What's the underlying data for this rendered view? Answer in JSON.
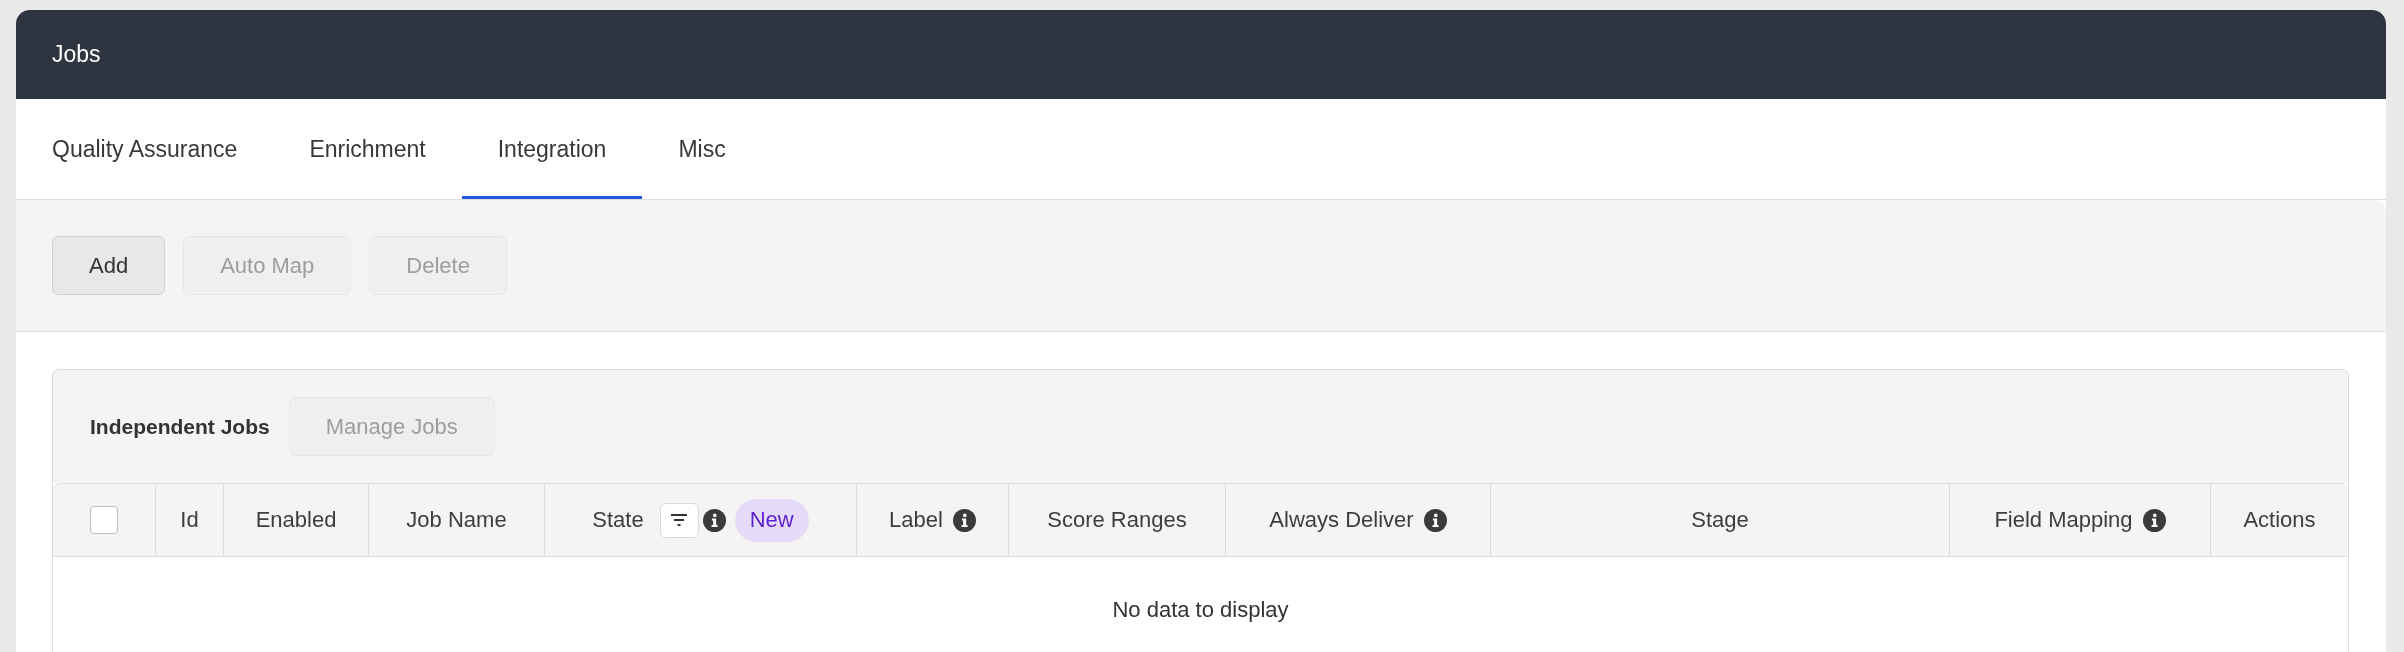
{
  "window": {
    "title": "Jobs"
  },
  "tabs": [
    {
      "label": "Quality Assurance",
      "selected": false
    },
    {
      "label": "Enrichment",
      "selected": false
    },
    {
      "label": "Integration",
      "selected": true
    },
    {
      "label": "Misc",
      "selected": false
    }
  ],
  "toolbar": {
    "buttons": [
      {
        "label": "Add",
        "disabled": false
      },
      {
        "label": "Auto Map",
        "disabled": true
      },
      {
        "label": "Delete",
        "disabled": true
      }
    ]
  },
  "panel": {
    "title": "Independent Jobs",
    "button": {
      "label": "Manage Jobs",
      "disabled": true
    }
  },
  "table": {
    "select_all": {
      "checked": false
    },
    "columns": [
      {
        "label": "Id",
        "filter": false,
        "info": false
      },
      {
        "label": "Enabled",
        "filter": false,
        "info": false
      },
      {
        "label": "Job Name",
        "filter": false,
        "info": false
      },
      {
        "label": "State",
        "filter": true,
        "info": true,
        "badge": "New"
      },
      {
        "label": "Label",
        "filter": false,
        "info": true
      },
      {
        "label": "Score Ranges",
        "filter": false,
        "info": false
      },
      {
        "label": "Always Deliver",
        "filter": false,
        "info": true
      },
      {
        "label": "Stage",
        "filter": false,
        "info": false
      },
      {
        "label": "Field Mapping",
        "filter": false,
        "info": true
      },
      {
        "label": "Actions",
        "filter": false,
        "info": false
      }
    ],
    "empty_message": "No data to display"
  }
}
